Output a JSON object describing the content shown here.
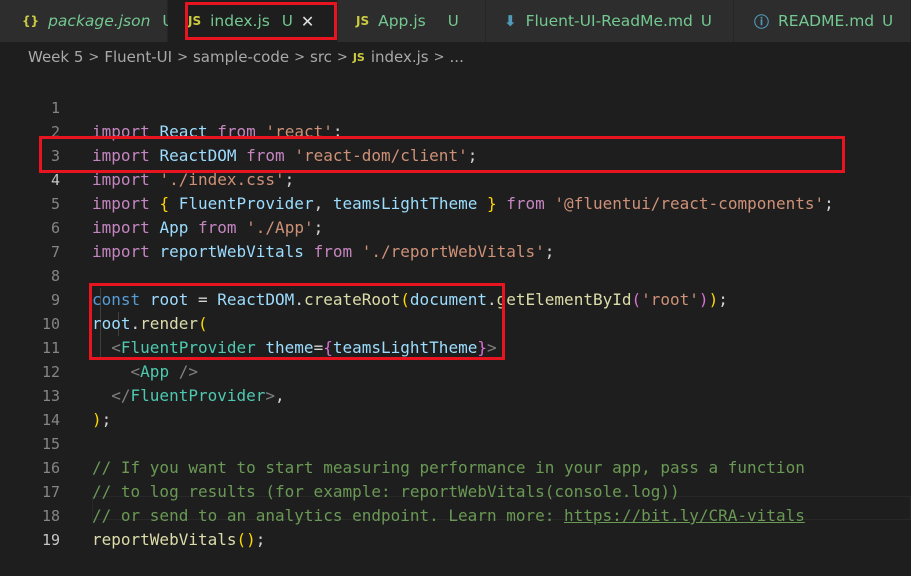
{
  "tabs": [
    {
      "icon": "{}",
      "label": "package.json",
      "status": "U",
      "italic": true
    },
    {
      "icon": "JS",
      "label": "index.js",
      "status": "U",
      "active": true,
      "close": "✕"
    },
    {
      "icon": "JS",
      "label": "App.js",
      "status": "U"
    },
    {
      "icon": "⬇",
      "label": "Fluent-UI-ReadMe.md",
      "status": "U"
    },
    {
      "icon": "ⓘ",
      "label": "README.md",
      "status": "U"
    }
  ],
  "breadcrumb": {
    "items": [
      "Week 5",
      "Fluent-UI",
      "sample-code",
      "src"
    ],
    "file_icon": "JS",
    "file": "index.js",
    "ellipsis": "..."
  },
  "line_numbers": [
    "1",
    "2",
    "3",
    "4",
    "5",
    "6",
    "7",
    "8",
    "9",
    "10",
    "11",
    "12",
    "13",
    "14",
    "15",
    "16",
    "17",
    "18",
    "19"
  ],
  "code": {
    "l1": {
      "a": "import",
      "b": "React",
      "c": "from",
      "d": "'react'",
      "e": ";"
    },
    "l2": {
      "a": "import",
      "b": "ReactDOM",
      "c": "from",
      "d": "'react-dom/client'",
      "e": ";"
    },
    "l3": {
      "a": "import",
      "d": "'./index.css'",
      "e": ";"
    },
    "l4": {
      "a": "import",
      "b1": "{",
      "b": " FluentProvider",
      "x": ",",
      "b2": " teamsLightTheme",
      "b3": " }",
      "c": "from",
      "d": "'@fluentui/react-components'",
      "e": ";"
    },
    "l5": {
      "a": "import",
      "b": "App",
      "c": "from",
      "d": "'./App'",
      "e": ";"
    },
    "l6": {
      "a": "import",
      "b": "reportWebVitals",
      "c": "from",
      "d": "'./reportWebVitals'",
      "e": ";"
    },
    "l8": {
      "a": "const",
      "b": "root",
      "op": " = ",
      "o": "ReactDOM",
      "dot": ".",
      "f": "createRoot",
      "p1": "(",
      "o2": "document",
      "dot2": ".",
      "f2": "getElementById",
      "p2": "(",
      "d": "'root'",
      "p3": ")",
      "p4": ")",
      "e": ";"
    },
    "l9": {
      "o": "root",
      "dot": ".",
      "f": "render",
      "p1": "("
    },
    "l10": {
      "lt": "<",
      "tn": "FluentProvider",
      "at": " theme",
      "eq": "=",
      "b1": "{",
      "v": "teamsLightTheme",
      "b2": "}",
      "gt": ">"
    },
    "l11": {
      "lt": "<",
      "tn": "App",
      "sl": " />"
    },
    "l12": {
      "lt": "</",
      "tn": "FluentProvider",
      "gt": ">",
      "cm": ","
    },
    "l13": {
      "p": ")",
      "e": ";"
    },
    "l15": {
      "c": "// If you want to start measuring performance in your app, pass a function"
    },
    "l16": {
      "c": "// to log results (for example: reportWebVitals(console.log))"
    },
    "l17": {
      "c": "// or send to an analytics endpoint. Learn more: ",
      "lnk": "https://bit.ly/CRA-vitals"
    },
    "l18": {
      "f": "reportWebVitals",
      "p": "()",
      "e": ";"
    }
  },
  "colors": {
    "highlight": "#e8141f",
    "background": "#1e1e1e",
    "untracked": "#73c991"
  }
}
